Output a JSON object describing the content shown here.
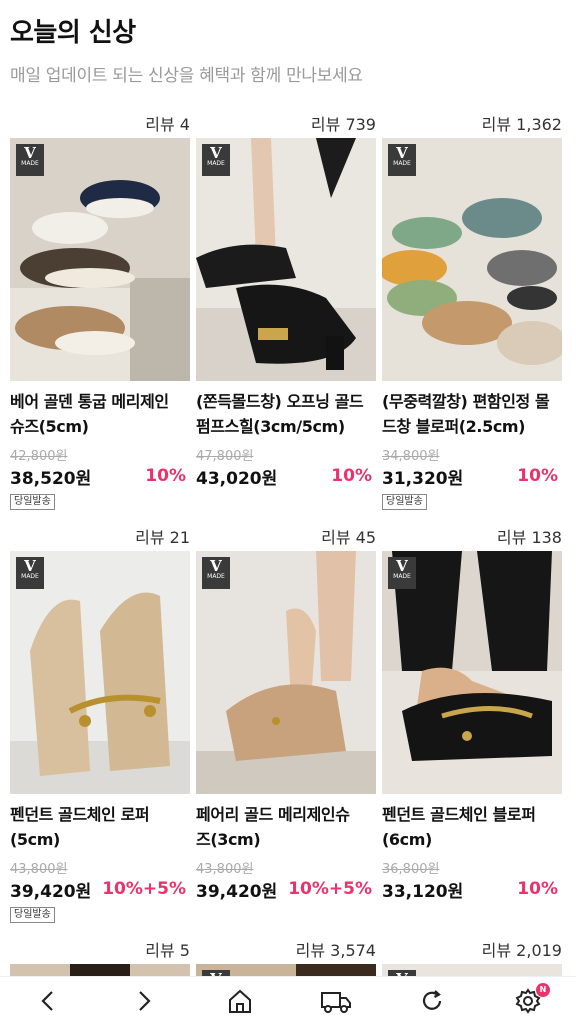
{
  "header": {
    "title": "오늘의 신상",
    "subtitle": "매일 업데이트 되는 신상을 혜택과 함께 만나보세요"
  },
  "badge_text": "MADE",
  "products": [
    {
      "review": "리뷰 4",
      "name1": "베어 골덴 통굽 메리제인",
      "name2": "슈즈(5cm)",
      "orig": "42,800원",
      "price": "38,520원",
      "discount": "10%",
      "tag": "당일발송"
    },
    {
      "review": "리뷰 739",
      "name1": "(쫀득몰드창) 오프닝 골드",
      "name2": "펌프스힐(3cm/5cm)",
      "orig": "47,800원",
      "price": "43,020원",
      "discount": "10%",
      "tag": ""
    },
    {
      "review": "리뷰 1,362",
      "name1": "(무중력깔창) 편함인정 몰",
      "name2": "드창 블로퍼(2.5cm)",
      "orig": "34,800원",
      "price": "31,320원",
      "discount": "10%",
      "tag": "당일발송"
    },
    {
      "review": "리뷰 21",
      "name1": "펜던트 골드체인 로퍼",
      "name2": "(5cm)",
      "orig": "43,800원",
      "price": "39,420원",
      "discount": "10%+5%",
      "tag": "당일발송"
    },
    {
      "review": "리뷰 45",
      "name1": "페어리 골드 메리제인슈",
      "name2": "즈(3cm)",
      "orig": "43,800원",
      "price": "39,420원",
      "discount": "10%+5%",
      "tag": ""
    },
    {
      "review": "리뷰 138",
      "name1": "펜던트 골드체인 블로퍼",
      "name2": "(6cm)",
      "orig": "36,800원",
      "price": "33,120원",
      "discount": "10%",
      "tag": ""
    },
    {
      "review": "리뷰 5"
    },
    {
      "review": "리뷰 3,574"
    },
    {
      "review": "리뷰 2,019"
    }
  ],
  "nav": {
    "icons": [
      "back-icon",
      "forward-icon",
      "home-icon",
      "delivery-truck-icon",
      "refresh-icon",
      "settings-icon"
    ],
    "notification": "N"
  }
}
